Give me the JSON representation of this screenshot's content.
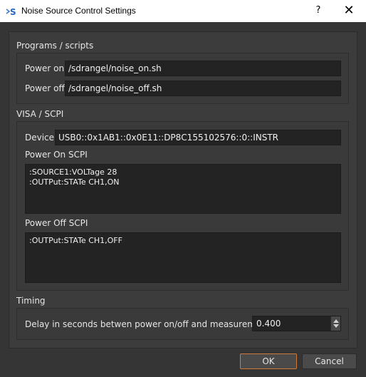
{
  "window": {
    "title": "Noise Source Control Settings",
    "help_glyph": "?",
    "close_glyph": "✕",
    "icon": "sdrangel-logo-icon"
  },
  "programs": {
    "section_title": "Programs / scripts",
    "power_on_label": "Power on",
    "power_on_value": "/sdrangel/noise_on.sh",
    "power_off_label": "Power off",
    "power_off_value": "/sdrangel/noise_off.sh"
  },
  "visa": {
    "section_title": "VISA / SCPI",
    "device_label": "Device",
    "device_value": "USB0::0x1AB1::0x0E11::DP8C155102576::0::INSTR",
    "power_on_scpi_label": "Power On SCPI",
    "power_on_scpi_lines": [
      ":SOURCE1:VOLTage 28",
      ":OUTPut:STATe CH1,ON"
    ],
    "power_off_scpi_label": "Power Off SCPI",
    "power_off_scpi_lines": [
      ":OUTPut:STATe CH1,OFF"
    ]
  },
  "timing": {
    "section_title": "Timing",
    "delay_label": "Delay in seconds betwen power on/off and measurement",
    "delay_value": "0.400"
  },
  "buttons": {
    "ok_label": "OK",
    "cancel_label": "Cancel"
  },
  "colors": {
    "background": "#353535",
    "accent": "#d07a3a",
    "field": "#232323"
  }
}
